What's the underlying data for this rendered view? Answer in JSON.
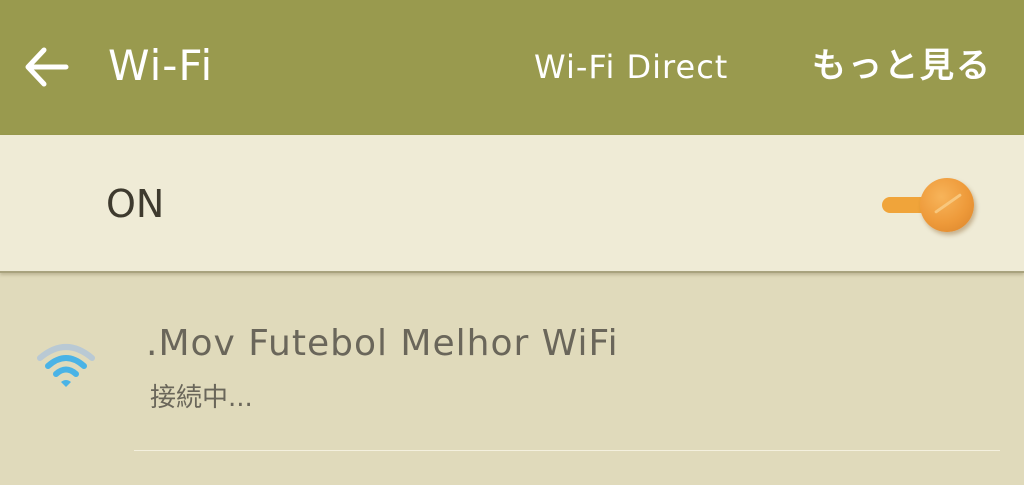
{
  "appbar": {
    "back_icon": "arrow-left-icon",
    "title": "Wi-Fi",
    "wifi_direct_label": "Wi-Fi Direct",
    "more_label": "もっと見る",
    "background_color": "#999a4e"
  },
  "toggle": {
    "label": "ON",
    "state": "on",
    "accent_color": "#f0a43a"
  },
  "networks": [
    {
      "name": ".Mov Futebol Melhor WiFi",
      "status": "接続中...",
      "icon": "wifi-signal-icon",
      "signal_color": "#4ab3e6"
    }
  ]
}
